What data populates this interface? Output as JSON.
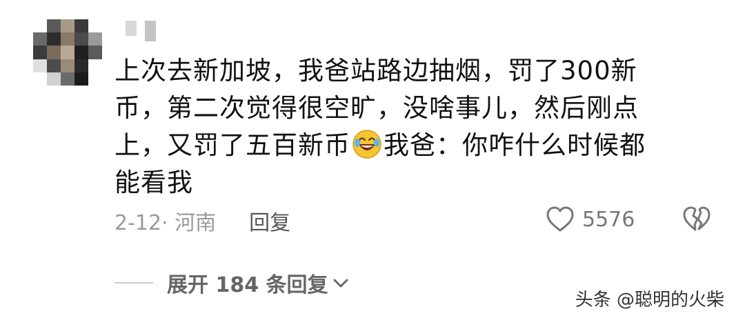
{
  "comment": {
    "line1": "上次去新加坡，我爸站路边抽烟，罚了300新",
    "line2": "币，第二次觉得很空旷，没啥事儿，然后刚点",
    "line3a": "上，又罚了五百新币",
    "line3_emoji": "laughing-face-emoji",
    "line3b": "我爸：你咋什么时候都",
    "line4": "能看我"
  },
  "meta": {
    "date_location": "2-12· 河南",
    "reply_label": "回复"
  },
  "likes": {
    "count": "5576"
  },
  "replies": {
    "expand_label": "展开 184 条回复"
  },
  "watermark": {
    "text": "头条 @聪明的火柴"
  },
  "colors": {
    "text": "#111111",
    "meta": "#9a9a9a",
    "icon": "#777777"
  }
}
